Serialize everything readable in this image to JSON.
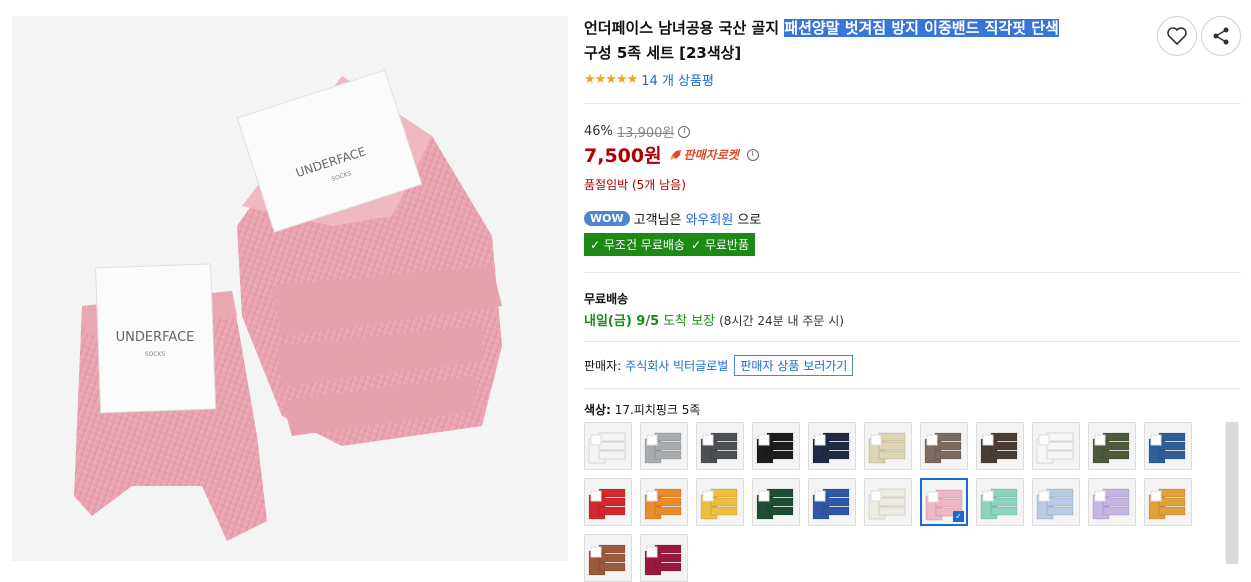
{
  "product": {
    "title_part1": "언더페이스 남녀공용 국산 골지 ",
    "title_highlight": "패션양말 벗겨짐 방지 이중밴드 직각핏 단색",
    "title_part2": "구성 5족 세트 [23색상]",
    "stars": "★★★★★",
    "review_count": "14 개 상품평"
  },
  "actions": {
    "wishlist_icon": "heart-icon",
    "share_icon": "share-icon"
  },
  "pricing": {
    "discount": "46%",
    "original_price": "13,900원",
    "price": "7,500원",
    "rocket_label": "판매자로켓",
    "stock_text": "품절임박 (5개 남음)",
    "price_color": "#ae0000"
  },
  "wow": {
    "badge": "WOW",
    "text_pre": "고객님은 ",
    "member": "와우회원",
    "text_post": "으로",
    "free_shipping": "✓ 무조건 무료배송",
    "free_return": "✓ 무료반품",
    "badge_color": "#1d8a16"
  },
  "shipping": {
    "title": "무료배송",
    "date": "내일(금) 9/5",
    "date_note": "도착 보장",
    "note": "(8시간 24분 내 주문 시)"
  },
  "seller": {
    "label": "판매자:",
    "name": "주식회사 빅터글로벌",
    "button": "판매자 상품 보러가기"
  },
  "options": {
    "label": "색상:",
    "selected": "17.피치핑크 5족",
    "swatches": [
      {
        "color": "#f4f4f4"
      },
      {
        "color": "#a9acaf"
      },
      {
        "color": "#4c4f54"
      },
      {
        "color": "#1c1c1c"
      },
      {
        "color": "#1f2a44"
      },
      {
        "color": "#ddd5b4"
      },
      {
        "color": "#7d6b5f"
      },
      {
        "color": "#4a3d36"
      },
      {
        "color": "#f7f7f7"
      },
      {
        "color": "#4f5a3a"
      },
      {
        "color": "#2f5f97"
      },
      {
        "color": "#d3282e"
      },
      {
        "color": "#ea8a2b"
      },
      {
        "color": "#eebf3e"
      },
      {
        "color": "#1f4d35"
      },
      {
        "color": "#2f57a8"
      },
      {
        "color": "#eeece2"
      },
      {
        "color": "#efb7c6"
      },
      {
        "color": "#8bd4c0"
      },
      {
        "color": "#b7cbe6"
      },
      {
        "color": "#c5b5e3"
      },
      {
        "color": "#e0a03a"
      },
      {
        "color": "#9a5a3e"
      },
      {
        "color": "#9a1740"
      }
    ],
    "selected_index": 17
  }
}
